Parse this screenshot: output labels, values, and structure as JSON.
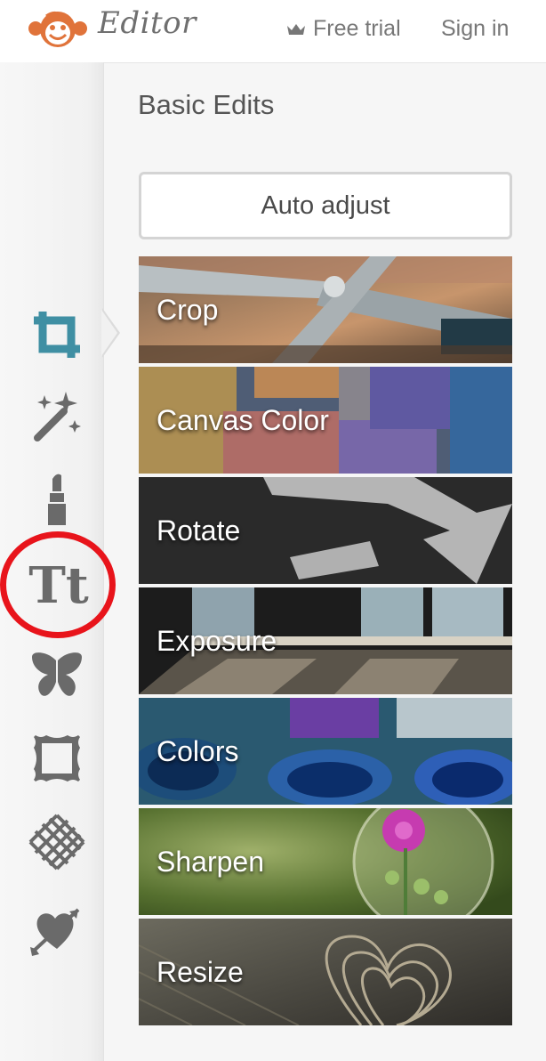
{
  "header": {
    "app_title": "Editor",
    "free_trial": "Free trial",
    "sign_in": "Sign in"
  },
  "sidebar": {
    "icons": [
      "crop-icon",
      "magic-wand-icon",
      "lipstick-icon",
      "text-icon",
      "butterfly-icon",
      "frame-icon",
      "texture-icon",
      "heart-arrow-icon"
    ],
    "text_icon_label": "Tt",
    "active": "crop-icon",
    "highlighted": "text-icon"
  },
  "main": {
    "section_title": "Basic Edits",
    "auto_adjust": "Auto adjust",
    "tools": [
      {
        "label": "Crop"
      },
      {
        "label": "Canvas Color"
      },
      {
        "label": "Rotate"
      },
      {
        "label": "Exposure"
      },
      {
        "label": "Colors"
      },
      {
        "label": "Sharpen"
      },
      {
        "label": "Resize"
      }
    ]
  },
  "colors": {
    "accent_teal": "#3f8fa3",
    "highlight_red": "#e8141b",
    "logo_orange": "#e0733a"
  }
}
